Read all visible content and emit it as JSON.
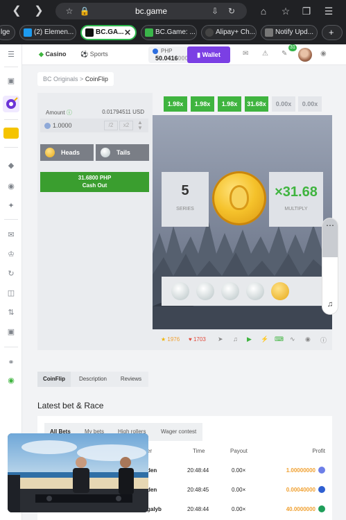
{
  "browser": {
    "url": "bc.game",
    "tabs": [
      {
        "label": "lge"
      },
      {
        "label": "(2) Elemen..."
      },
      {
        "label": "BC.GA..."
      },
      {
        "label": "BC.Game: ..."
      },
      {
        "label": "Alipay+ Ch..."
      },
      {
        "label": "Notify Upd..."
      }
    ]
  },
  "header": {
    "casino": "Casino",
    "sports": "Sports",
    "currency": "PHP",
    "balance_main": "50.0416",
    "balance_dim": "000",
    "wallet": "Wallet",
    "notif_count": "31"
  },
  "breadcrumb": {
    "parent": "BC Originals",
    "sep": ">",
    "current": "CoinFlip"
  },
  "controls": {
    "amount_label": "Amount",
    "amount_usd": "0.01794511 USD",
    "amount_value": "1.0000",
    "half": "/2",
    "double": "x2",
    "heads": "Heads",
    "tails": "Tails",
    "cashout_amount": "31.6800 PHP",
    "cashout_label": "Cash Out"
  },
  "multipliers": [
    "1.98x",
    "1.98x",
    "1.98x",
    "31.68x",
    "0.00x",
    "0.00x"
  ],
  "game": {
    "series_value": "5",
    "series_label": "SERIES",
    "multiply_value": "×31.68",
    "multiply_label": "MULTIPLY"
  },
  "game_footer": {
    "likes": "1976",
    "favorites": "1703"
  },
  "tabs": {
    "t1": "CoinFlip",
    "t2": "Description",
    "t3": "Reviews"
  },
  "latest": {
    "title": "Latest bet & Race",
    "subtabs": [
      "All Bets",
      "My bets",
      "High rollers",
      "Wager contest"
    ],
    "columns": {
      "player": "er",
      "time": "Time",
      "payout": "Payout",
      "profit": "Profit"
    },
    "rows": [
      {
        "player": "den",
        "time": "20:48:44",
        "payout": "0.00×",
        "profit_a": "1.",
        "profit_b": "00000000"
      },
      {
        "player": "den",
        "time": "20:48:45",
        "payout": "0.00×",
        "profit_a": "0.0004",
        "profit_b": "0000"
      },
      {
        "player": "galyb",
        "time": "20:48:44",
        "payout": "0.00×",
        "profit_a": "40.",
        "profit_b": "0000000"
      }
    ]
  },
  "colors": {
    "accent_green": "#3fb43f",
    "brand_purple": "#7b3fe4",
    "profit_orange": "#f0a030"
  }
}
